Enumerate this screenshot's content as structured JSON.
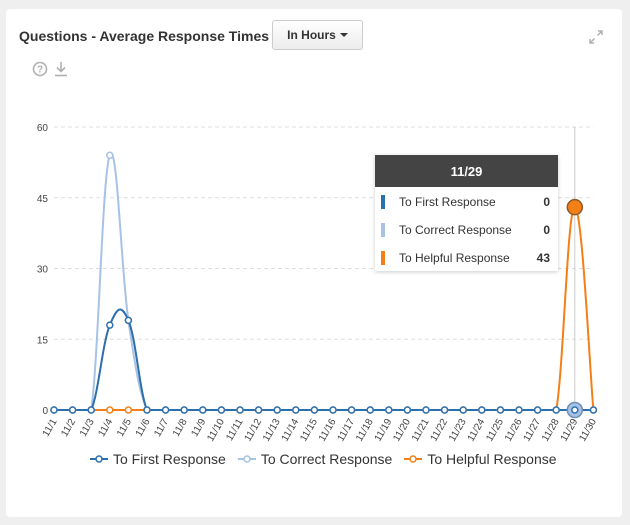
{
  "header": {
    "title": "Questions - Average Response Times",
    "dropdown_label": "In Hours"
  },
  "chart_data": {
    "type": "line",
    "title": "Questions - Average Response Times",
    "xlabel": "",
    "ylabel": "",
    "ylim": [
      0,
      60
    ],
    "yticks": [
      0,
      15,
      30,
      45,
      60
    ],
    "grid": true,
    "legend_position": "bottom",
    "categories": [
      "11/1",
      "11/2",
      "11/3",
      "11/4",
      "11/5",
      "11/6",
      "11/7",
      "11/8",
      "11/9",
      "11/10",
      "11/11",
      "11/12",
      "11/13",
      "11/14",
      "11/15",
      "11/16",
      "11/17",
      "11/18",
      "11/19",
      "11/20",
      "11/21",
      "11/22",
      "11/23",
      "11/24",
      "11/25",
      "11/26",
      "11/27",
      "11/28",
      "11/29",
      "11/30"
    ],
    "series": [
      {
        "name": "To First Response",
        "color": "#2c6fad",
        "values": [
          0,
          0,
          0,
          18,
          19,
          0,
          0,
          0,
          0,
          0,
          0,
          0,
          0,
          0,
          0,
          0,
          0,
          0,
          0,
          0,
          0,
          0,
          0,
          0,
          0,
          0,
          0,
          0,
          0,
          0
        ]
      },
      {
        "name": "To Correct Response",
        "color": "#a6c3e6",
        "values": [
          0,
          0,
          0,
          54,
          19,
          0,
          0,
          0,
          0,
          0,
          0,
          0,
          0,
          0,
          0,
          0,
          0,
          0,
          0,
          0,
          0,
          0,
          0,
          0,
          0,
          0,
          0,
          0,
          0,
          0
        ]
      },
      {
        "name": "To Helpful Response",
        "color": "#f57f17",
        "values": [
          0,
          0,
          0,
          0,
          0,
          0,
          0,
          0,
          0,
          0,
          0,
          0,
          0,
          0,
          0,
          0,
          0,
          0,
          0,
          0,
          0,
          0,
          0,
          0,
          0,
          0,
          0,
          0,
          43,
          0
        ]
      }
    ],
    "tooltip": {
      "date": "11/29",
      "rows": [
        {
          "label": "To First Response",
          "value": "0",
          "color": "#2c6fad"
        },
        {
          "label": "To Correct Response",
          "value": "0",
          "color": "#a6c3e6"
        },
        {
          "label": "To Helpful Response",
          "value": "43",
          "color": "#f57f17"
        }
      ]
    },
    "highlighted_index": 28
  },
  "icons": {
    "help": "help-icon",
    "download": "download-icon",
    "expand": "expand-icon"
  }
}
